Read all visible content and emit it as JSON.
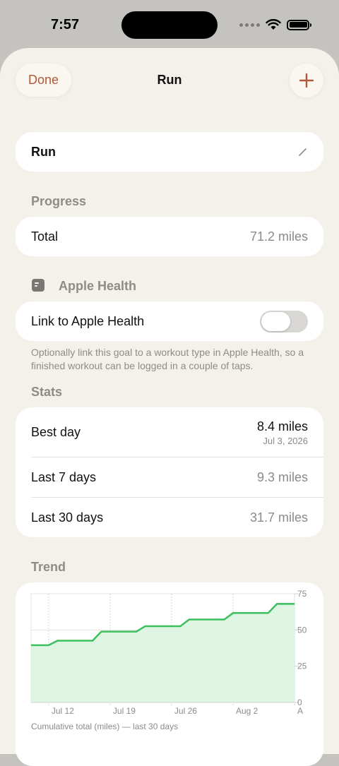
{
  "status_bar": {
    "time": "7:57"
  },
  "nav": {
    "done_label": "Done",
    "title": "Run",
    "add_label": "+"
  },
  "goal": {
    "name": "Run"
  },
  "progress": {
    "section_label": "Progress",
    "total_label": "Total",
    "total_value": "71.2 miles"
  },
  "health": {
    "section_label": "Apple Health",
    "link_label": "Link to Apple Health",
    "link_enabled": false,
    "helper_text": "Optionally link this goal to a workout type in Apple Health, so a finished workout can be logged in a couple of taps."
  },
  "stats": {
    "section_label": "Stats",
    "best_day_label": "Best day",
    "best_day_value": "8.4 miles",
    "best_day_date": "Jul 3, 2026",
    "last7_label": "Last 7 days",
    "last7_value": "9.3 miles",
    "last30_label": "Last 30 days",
    "last30_value": "31.7 miles"
  },
  "trend": {
    "section_label": "Trend"
  },
  "colors": {
    "accent": "#b05a3a",
    "chart_line": "#3cbf5c",
    "chart_fill": "#dff5e3"
  },
  "chart_data": {
    "type": "area",
    "caption": "Cumulative total (miles) — last 30 days",
    "x_tick_labels": [
      "Jul 12",
      "Jul 19",
      "Jul 26",
      "Aug 2",
      "A"
    ],
    "y_ticks": [
      0,
      25,
      50,
      75
    ],
    "ylim": [
      0,
      75
    ],
    "grid": true,
    "y_axis_side": "right",
    "series": [
      {
        "x": [
          "Jul 10",
          "Jul 11",
          "Jul 12",
          "Jul 13",
          "Jul 14",
          "Jul 15",
          "Jul 16",
          "Jul 17",
          "Jul 18",
          "Jul 19",
          "Jul 20",
          "Jul 21",
          "Jul 22",
          "Jul 23",
          "Jul 24",
          "Jul 25",
          "Jul 26",
          "Jul 27",
          "Jul 28",
          "Jul 29",
          "Jul 30",
          "Jul 31",
          "Aug 1",
          "Aug 2",
          "Aug 3",
          "Aug 4",
          "Aug 5",
          "Aug 6",
          "Aug 7",
          "Aug 8",
          "Aug 9"
        ],
        "values": [
          39.5,
          39.5,
          39.5,
          42.6,
          42.6,
          42.6,
          42.6,
          42.6,
          48.9,
          48.9,
          48.9,
          48.9,
          48.9,
          52.6,
          52.6,
          52.6,
          52.6,
          52.6,
          57.2,
          57.2,
          57.2,
          57.2,
          57.2,
          61.7,
          61.7,
          61.7,
          61.7,
          61.7,
          68.0,
          68.0,
          68.0
        ]
      }
    ]
  }
}
